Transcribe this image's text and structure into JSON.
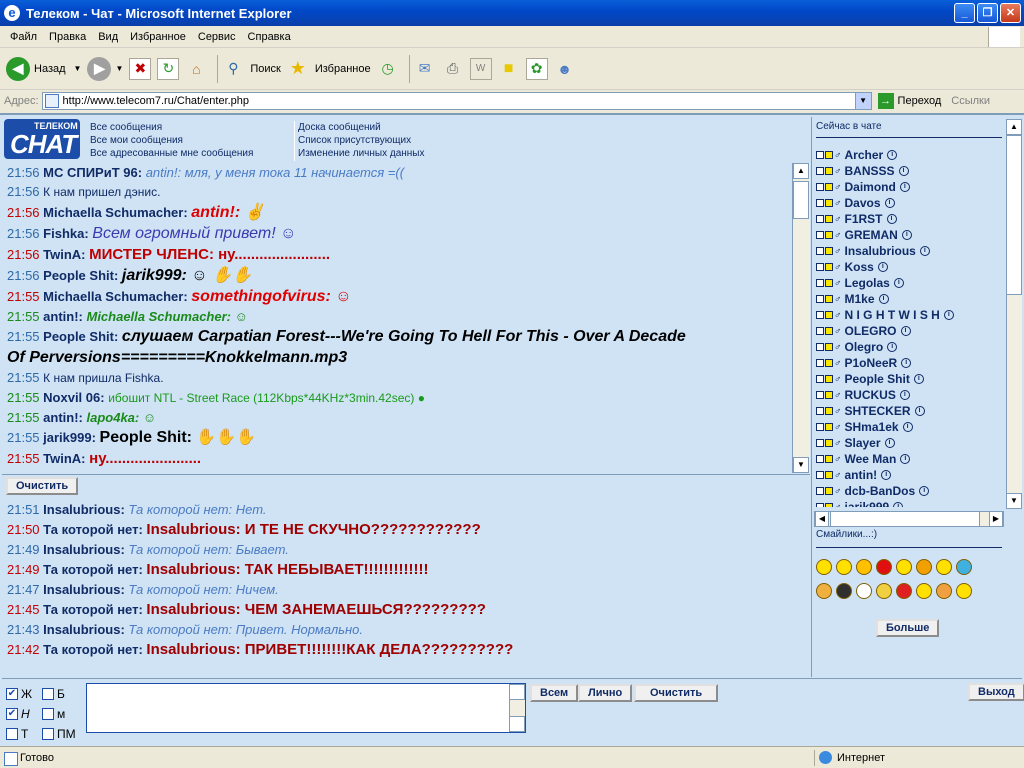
{
  "window": {
    "title": "Телеком - Чат - Microsoft Internet Explorer"
  },
  "menu": [
    "Файл",
    "Правка",
    "Вид",
    "Избранное",
    "Сервис",
    "Справка"
  ],
  "toolbar": {
    "back": "Назад",
    "search": "Поиск",
    "favorites": "Избранное"
  },
  "address": {
    "label": "Адрес:",
    "url": "http://www.telecom7.ru/Chat/enter.php",
    "go": "Переход",
    "links": "Ссылки"
  },
  "logo": {
    "line1": "ТЕЛЕКОМ",
    "line2": "CHAT"
  },
  "nav": {
    "col1": [
      "Все сообщения",
      "Все мои сообщения",
      "Все адресованные мне сообщения"
    ],
    "col2": [
      "Доска сообщений",
      "Список присутствующих",
      "Изменение личных данных"
    ]
  },
  "messages": [
    {
      "time": "21:56",
      "tc": "#2E6AA8",
      "nick": "МС СПИРиТ 96:",
      "text": "antin!: мля, у меня тока 11 начинается =((",
      "color": "#4A7BC4",
      "size": 13,
      "bold": false,
      "italic": true
    },
    {
      "time": "21:56",
      "tc": "#2E6AA8",
      "nick": "",
      "text": "К нам пришел дэнис.",
      "color": "#102B66",
      "size": 12,
      "bold": false,
      "italic": false
    },
    {
      "time": "21:56",
      "tc": "#C00000",
      "nick": "Michaella Schumacher:",
      "text": "antin!: ✌",
      "color": "#E00000",
      "size": 16,
      "bold": true,
      "italic": true
    },
    {
      "time": "21:56",
      "tc": "#2E6AA8",
      "nick": "Fishka:",
      "text": "Всем огромный привет! ☺",
      "color": "#3A3AB0",
      "size": 16,
      "bold": false,
      "italic": true
    },
    {
      "time": "21:56",
      "tc": "#C00000",
      "nick": "TwinA:",
      "text": "МИСТЕР ЧЛЕНС: ну.......................",
      "color": "#C00000",
      "size": 15,
      "bold": true,
      "italic": false
    },
    {
      "time": "21:56",
      "tc": "#2E6AA8",
      "nick": "People Shit:",
      "text": "jarik999: ☺ ✋✋",
      "color": "#000000",
      "size": 16,
      "bold": true,
      "italic": true
    },
    {
      "time": "21:55",
      "tc": "#C00000",
      "nick": "Michaella Schumacher:",
      "text": "somethingofvirus: ☺",
      "color": "#E00000",
      "size": 16,
      "bold": true,
      "italic": true
    },
    {
      "time": "21:55",
      "tc": "#1A8A1A",
      "nick": "antin!:",
      "text": "Michaella Schumacher: ☺",
      "color": "#1A8A1A",
      "size": 13,
      "bold": true,
      "italic": true
    },
    {
      "time": "21:55",
      "tc": "#2E6AA8",
      "nick": "People Shit:",
      "text": "слушаем Carpatian Forest---We're Going To Hell For This - Over A Decade",
      "color": "#000000",
      "size": 16,
      "bold": true,
      "italic": true
    },
    {
      "time": "",
      "tc": "#2E6AA8",
      "nick": "",
      "text": "Of Perversions=========Knokkelmann.mp3",
      "color": "#000000",
      "size": 16,
      "bold": true,
      "italic": true
    },
    {
      "time": "21:55",
      "tc": "#2E6AA8",
      "nick": "",
      "text": "К нам пришла Fishka.",
      "color": "#102B66",
      "size": 12,
      "bold": false,
      "italic": false
    },
    {
      "time": "21:55",
      "tc": "#1A8A1A",
      "nick": "Noxvil 06:",
      "text": "ибошит NTL - Street Race (112Kbps*44KHz*3min.42sec) ●",
      "color": "#1A9A1A",
      "size": 12,
      "bold": false,
      "italic": false
    },
    {
      "time": "21:55",
      "tc": "#1A8A1A",
      "nick": "antin!:",
      "text": "lapo4ka: ☺",
      "color": "#1A8A1A",
      "size": 13,
      "bold": true,
      "italic": true
    },
    {
      "time": "21:55",
      "tc": "#2E6AA8",
      "nick": "jarik999:",
      "text": "People Shit: ✋✋✋",
      "color": "#000000",
      "size": 16,
      "bold": true,
      "italic": false
    },
    {
      "time": "21:55",
      "tc": "#C00000",
      "nick": "TwinA:",
      "text": "ну.......................",
      "color": "#C00000",
      "size": 15,
      "bold": true,
      "italic": false
    }
  ],
  "clear_label": "Очистить",
  "private": [
    {
      "time": "21:51",
      "tc": "#2E6AA8",
      "nick": "Insalubrious:",
      "text": "Та которой нет: Нет.",
      "color": "#4A7BC4",
      "size": 13,
      "bold": false,
      "italic": true
    },
    {
      "time": "21:50",
      "tc": "#C00000",
      "nick": "Та которой нет:",
      "text": "Insalubrious: И ТЕ НЕ СКУЧНО????????????",
      "color": "#A00000",
      "size": 15,
      "bold": true,
      "italic": false
    },
    {
      "time": "21:49",
      "tc": "#2E6AA8",
      "nick": "Insalubrious:",
      "text": "Та которой нет: Бывает.",
      "color": "#4A7BC4",
      "size": 13,
      "bold": false,
      "italic": true
    },
    {
      "time": "21:49",
      "tc": "#C00000",
      "nick": "Та которой нет:",
      "text": "Insalubrious: ТАК НЕБЫВАЕТ!!!!!!!!!!!!!",
      "color": "#A00000",
      "size": 15,
      "bold": true,
      "italic": false
    },
    {
      "time": "21:47",
      "tc": "#2E6AA8",
      "nick": "Insalubrious:",
      "text": "Та которой нет: Ничем.",
      "color": "#4A7BC4",
      "size": 13,
      "bold": false,
      "italic": true
    },
    {
      "time": "21:45",
      "tc": "#C00000",
      "nick": "Та которой нет:",
      "text": "Insalubrious: ЧЕМ ЗАНЕМАЕШЬСЯ?????????",
      "color": "#A00000",
      "size": 15,
      "bold": true,
      "italic": false
    },
    {
      "time": "21:43",
      "tc": "#2E6AA8",
      "nick": "Insalubrious:",
      "text": "Та которой нет: Привет. Нормально.",
      "color": "#4A7BC4",
      "size": 13,
      "bold": false,
      "italic": true
    },
    {
      "time": "21:42",
      "tc": "#C00000",
      "nick": "Та которой нет:",
      "text": "Insalubrious: ПРИВЕТ!!!!!!!!КАК ДЕЛА??????????",
      "color": "#A00000",
      "size": 15,
      "bold": true,
      "italic": false
    }
  ],
  "options": {
    "bold": "Ж",
    "b": "Б",
    "italic": "Н",
    "m": "м",
    "t": "Т",
    "pm": "ПМ"
  },
  "buttons": {
    "all": "Всем",
    "private": "Лично",
    "clear": "Очистить",
    "exit": "Выход"
  },
  "online": {
    "title": "Сейчас в чате",
    "users": [
      "Archer",
      "BANSSS",
      "Daimond",
      "Davos",
      "F1RST",
      "GREMAN",
      "Insalubrious",
      "Koss",
      "Legolas",
      "M1ke",
      "N I G H T W I S H",
      "OLEGRO",
      "Olegro",
      "P1oNeeR",
      "People Shit",
      "RUCKUS",
      "SHTECKER",
      "SHma1ek",
      "Slayer",
      "Wee Man",
      "antin!",
      "dcb-BanDos",
      "jarik999"
    ]
  },
  "smiles": {
    "title": "Смайлики...:)",
    "more": "Больше"
  },
  "status": {
    "text": "Готово",
    "zone": "Интернет"
  }
}
